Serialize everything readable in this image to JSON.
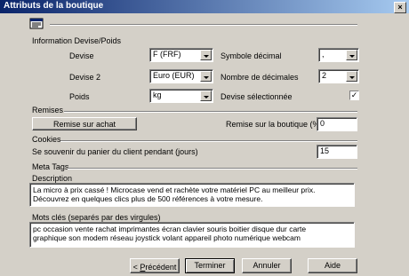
{
  "window": {
    "title": "Attributs de la boutique",
    "close_label": "×"
  },
  "sections": {
    "devise": "Information Devise/Poids",
    "remises": "Remises",
    "cookies": "Cookies",
    "meta": "Meta Tags"
  },
  "devise": {
    "devise_label": "Devise",
    "devise_value": "F (FRF)",
    "devise2_label": "Devise 2",
    "devise2_value": "Euro (EUR)",
    "poids_label": "Poids",
    "poids_value": "kg",
    "symbole_label": "Symbole décimal",
    "symbole_value": ",",
    "decimales_label": "Nombre de décimales",
    "decimales_value": "2",
    "selectionnee_label": "Devise sélectionnée",
    "selectionnee_checked": "✓"
  },
  "remises": {
    "button_label": "Remise sur achat",
    "boutique_label": "Remise sur la boutique (%)",
    "boutique_value": "0"
  },
  "cookies": {
    "label": "Se souvenir du panier du client pendant (jours)",
    "value": "15"
  },
  "meta": {
    "description_label": "Description",
    "description_value": "La micro à prix cassé ! Microcase vend et rachète votre matériel PC au meilleur prix.\nDécouvrez en quelques clics plus de 500 références à votre mesure.",
    "keywords_label": "Mots clés (separés par des virgules)",
    "keywords_value": "pc occasion vente rachat imprimantes écran clavier souris boitier disque dur carte\ngraphique son modem réseau joystick volant appareil photo numérique webcam"
  },
  "footer": {
    "prev_prefix": "< ",
    "prev_accel": "P",
    "prev_rest": "récédent",
    "finish": "Terminer",
    "cancel": "Annuler",
    "help": "Aide"
  }
}
